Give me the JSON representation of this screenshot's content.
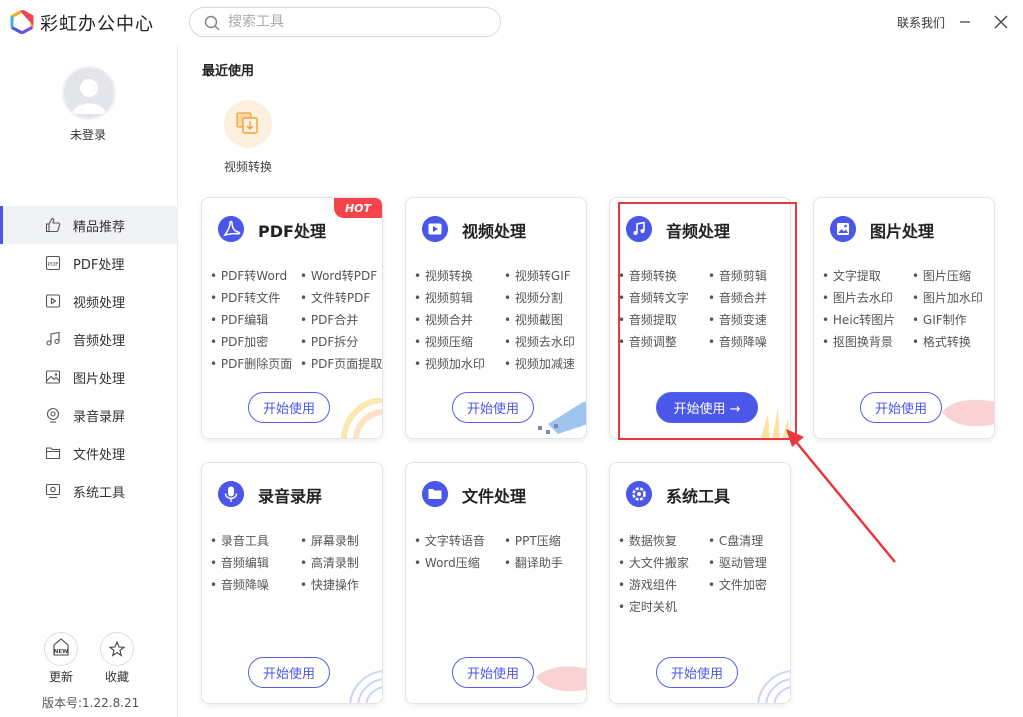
{
  "app": {
    "title": "彩虹办公中心"
  },
  "search": {
    "placeholder": "搜索工具"
  },
  "header": {
    "contact": "联系我们"
  },
  "user": {
    "status": "未登录"
  },
  "sidebar": {
    "items": [
      {
        "label": "精品推荐",
        "icon": "thumbs-up-icon"
      },
      {
        "label": "PDF处理",
        "icon": "pdf-icon"
      },
      {
        "label": "视频处理",
        "icon": "video-icon"
      },
      {
        "label": "音频处理",
        "icon": "music-note-icon"
      },
      {
        "label": "图片处理",
        "icon": "image-icon"
      },
      {
        "label": "录音录屏",
        "icon": "record-icon"
      },
      {
        "label": "文件处理",
        "icon": "folder-icon"
      },
      {
        "label": "系统工具",
        "icon": "system-icon"
      }
    ],
    "update_label": "更新",
    "favorite_label": "收藏",
    "version": "版本号:1.22.8.21"
  },
  "recent": {
    "title": "最近使用",
    "items": [
      {
        "label": "视频转换"
      }
    ]
  },
  "cards": [
    {
      "title": "PDF处理",
      "badge": "HOT",
      "button": "开始使用",
      "items": [
        "PDF转Word",
        "Word转PDF",
        "PDF转文件",
        "文件转PDF",
        "PDF编辑",
        "PDF合并",
        "PDF加密",
        "PDF拆分",
        "PDF删除页面",
        "PDF页面提取"
      ]
    },
    {
      "title": "视频处理",
      "button": "开始使用",
      "items": [
        "视频转换",
        "视频转GIF",
        "视频剪辑",
        "视频分割",
        "视频合并",
        "视频截图",
        "视频压缩",
        "视频去水印",
        "视频加水印",
        "视频加减速"
      ]
    },
    {
      "title": "音频处理",
      "button": "开始使用 →",
      "items": [
        "音频转换",
        "音频剪辑",
        "音频转文字",
        "音频合并",
        "音频提取",
        "音频变速",
        "音频调整",
        "音频降噪"
      ]
    },
    {
      "title": "图片处理",
      "button": "开始使用",
      "items": [
        "文字提取",
        "图片压缩",
        "图片去水印",
        "图片加水印",
        "Heic转图片",
        "GIF制作",
        "抠图换背景",
        "格式转换"
      ]
    },
    {
      "title": "录音录屏",
      "button": "开始使用",
      "items": [
        "录音工具",
        "屏幕录制",
        "音频编辑",
        "高清录制",
        "音频降噪",
        "快捷操作"
      ]
    },
    {
      "title": "文件处理",
      "button": "开始使用",
      "items": [
        "文字转语音",
        "PPT压缩",
        "Word压缩",
        "翻译助手"
      ]
    },
    {
      "title": "系统工具",
      "button": "开始使用",
      "items": [
        "数据恢复",
        "C盘清理",
        "大文件搬家",
        "驱动管理",
        "游戏组件",
        "文件加密",
        "定时关机"
      ]
    }
  ],
  "colors": {
    "accent": "#4b57e8",
    "hot": "#f4444b",
    "highlight": "#e8383d"
  }
}
